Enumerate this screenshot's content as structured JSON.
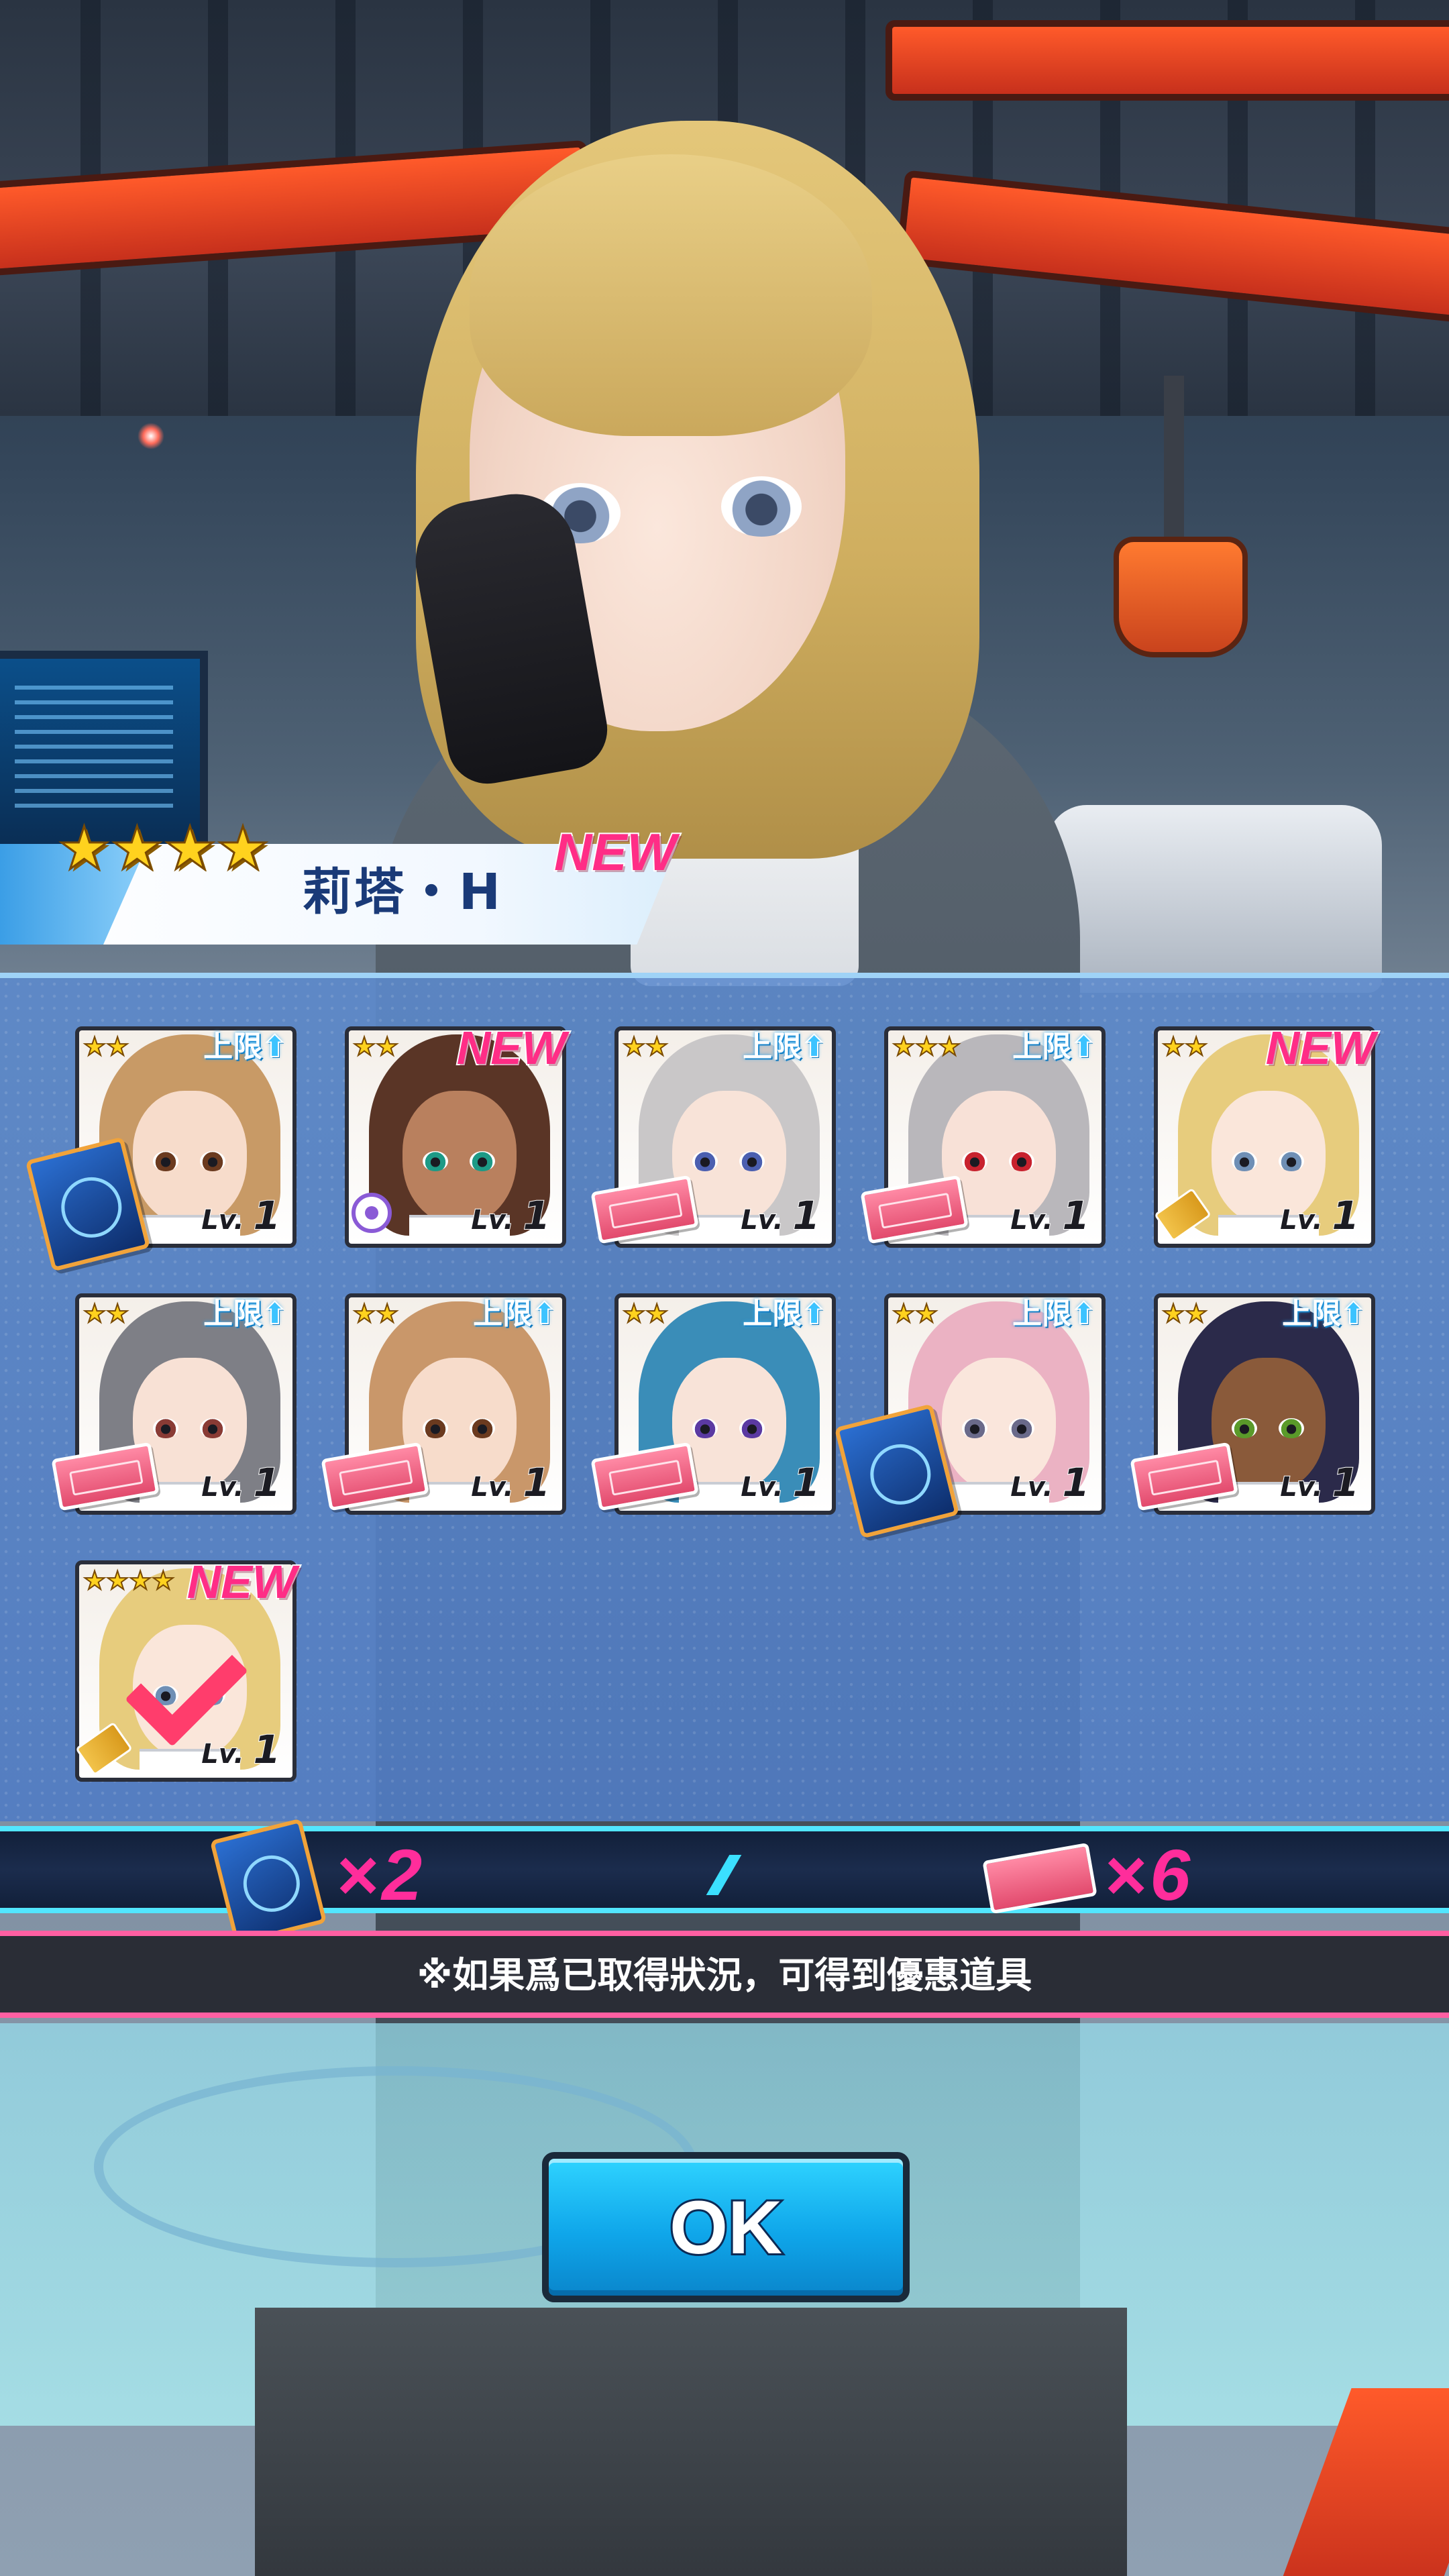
{
  "character": {
    "name": "莉塔・H",
    "stars": "★★★★",
    "new_label": "NEW"
  },
  "cards": [
    {
      "stars": "★★",
      "badge": "上限",
      "badge_type": "limit",
      "level_prefix": "Lv.",
      "level": "1",
      "item": "book-icon",
      "hair": "#c89a66",
      "skin": "#f7dccb",
      "eyes": "#6b3a1f"
    },
    {
      "stars": "★★",
      "badge": "NEW",
      "badge_type": "new",
      "level_prefix": "Lv.",
      "level": "1",
      "item": "target-icon",
      "hair": "#5a3526",
      "skin": "#b9805e",
      "eyes": "#1d9a86"
    },
    {
      "stars": "★★",
      "badge": "上限",
      "badge_type": "limit",
      "level_prefix": "Lv.",
      "level": "1",
      "item": "ticket-icon",
      "hair": "#c9c7c8",
      "skin": "#f8e3d8",
      "eyes": "#4b5fb0"
    },
    {
      "stars": "★★★",
      "badge": "上限",
      "badge_type": "limit",
      "level_prefix": "Lv.",
      "level": "1",
      "item": "ticket-icon",
      "hair": "#b9b7bb",
      "skin": "#f8e1d7",
      "eyes": "#c8222e"
    },
    {
      "stars": "★★",
      "badge": "NEW",
      "badge_type": "new",
      "level_prefix": "Lv.",
      "level": "1",
      "item": "gun-icon",
      "hair": "#e7cc7d",
      "skin": "#fae6da",
      "eyes": "#6f8fb5"
    },
    {
      "stars": "★★",
      "badge": "上限",
      "badge_type": "limit",
      "level_prefix": "Lv.",
      "level": "1",
      "item": "ticket-icon",
      "hair": "#7e7f86",
      "skin": "#f8e1d5",
      "eyes": "#8a3b35"
    },
    {
      "stars": "★★",
      "badge": "上限",
      "badge_type": "limit",
      "level_prefix": "Lv.",
      "level": "1",
      "item": "ticket-icon",
      "hair": "#c9976a",
      "skin": "#f7dccb",
      "eyes": "#6b3a1f"
    },
    {
      "stars": "★★",
      "badge": "上限",
      "badge_type": "limit",
      "level_prefix": "Lv.",
      "level": "1",
      "item": "ticket-icon",
      "hair": "#3a8db8",
      "skin": "#f8e3d8",
      "eyes": "#5b3aa2"
    },
    {
      "stars": "★★",
      "badge": "上限",
      "badge_type": "limit",
      "level_prefix": "Lv.",
      "level": "1",
      "item": "book-icon",
      "hair": "#ebb2c3",
      "skin": "#fae6dc",
      "eyes": "#6a6a8a"
    },
    {
      "stars": "★★",
      "badge": "上限",
      "badge_type": "limit",
      "level_prefix": "Lv.",
      "level": "1",
      "item": "ticket-icon",
      "hair": "#2b2a4a",
      "skin": "#8a5a3a",
      "eyes": "#5a9a2a"
    },
    {
      "stars": "★★★★",
      "badge": "NEW",
      "badge_type": "new",
      "level_prefix": "Lv.",
      "level": "1",
      "item": "gun-icon",
      "hair": "#e7cc7d",
      "skin": "#fae6da",
      "eyes": "#6f8fb5",
      "checked": true
    }
  ],
  "totals": {
    "book_count": "×2",
    "ticket_count": "×6"
  },
  "notice": "※如果爲已取得狀況，可得到優惠道具",
  "ok_label": "OK"
}
